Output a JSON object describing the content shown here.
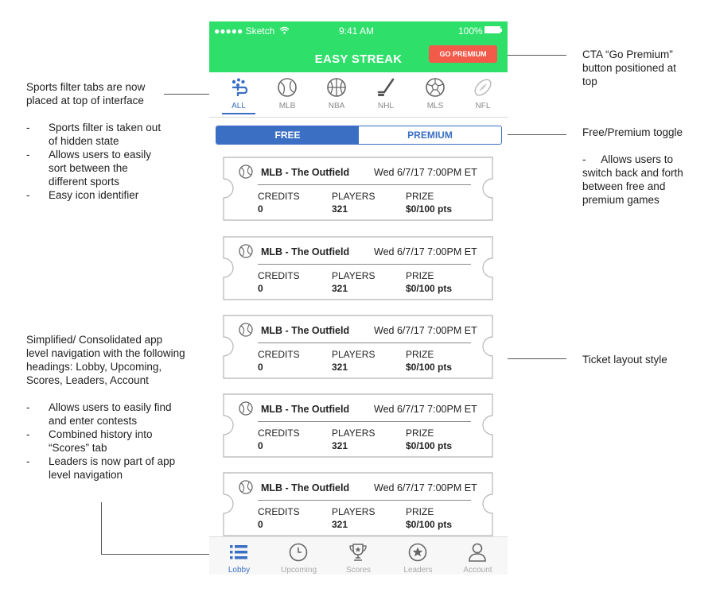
{
  "status_bar": {
    "carrier": "●●●●● Sketch",
    "time": "9:41 AM",
    "battery": "100%"
  },
  "header": {
    "title": "EASY STREAK",
    "premium_button": "GO PREMIUM"
  },
  "sport_tabs": [
    {
      "label": "ALL",
      "icon": "all-sports-icon",
      "active": true
    },
    {
      "label": "MLB",
      "icon": "baseball-icon"
    },
    {
      "label": "NBA",
      "icon": "basketball-icon"
    },
    {
      "label": "NHL",
      "icon": "hockey-icon"
    },
    {
      "label": "MLS",
      "icon": "soccer-icon"
    },
    {
      "label": "NFL",
      "icon": "football-icon"
    }
  ],
  "toggle": {
    "free": "FREE",
    "premium": "PREMIUM",
    "selected": "FREE"
  },
  "tickets": [
    {
      "name": "MLB - The Outfield",
      "date": "Wed 6/7/17 7:00PM ET",
      "credits_label": "CREDITS",
      "credits": "0",
      "players_label": "PLAYERS",
      "players": "321",
      "prize_label": "PRIZE",
      "prize": "$0/100 pts"
    },
    {
      "name": "MLB - The Outfield",
      "date": "Wed 6/7/17 7:00PM ET",
      "credits_label": "CREDITS",
      "credits": "0",
      "players_label": "PLAYERS",
      "players": "321",
      "prize_label": "PRIZE",
      "prize": "$0/100 pts"
    },
    {
      "name": "MLB - The Outfield",
      "date": "Wed 6/7/17 7:00PM ET",
      "credits_label": "CREDITS",
      "credits": "0",
      "players_label": "PLAYERS",
      "players": "321",
      "prize_label": "PRIZE",
      "prize": "$0/100 pts"
    },
    {
      "name": "MLB - The Outfield",
      "date": "Wed 6/7/17 7:00PM ET",
      "credits_label": "CREDITS",
      "credits": "0",
      "players_label": "PLAYERS",
      "players": "321",
      "prize_label": "PRIZE",
      "prize": "$0/100 pts"
    },
    {
      "name": "MLB - The Outfield",
      "date": "Wed 6/7/17 7:00PM ET",
      "credits_label": "CREDITS",
      "credits": "0",
      "players_label": "PLAYERS",
      "players": "321",
      "prize_label": "PRIZE",
      "prize": "$0/100 pts"
    }
  ],
  "bottom_nav": [
    {
      "label": "Lobby",
      "icon": "list-icon",
      "active": true
    },
    {
      "label": "Upcoming",
      "icon": "clock-icon"
    },
    {
      "label": "Scores",
      "icon": "trophy-icon"
    },
    {
      "label": "Leaders",
      "icon": "star-badge-icon"
    },
    {
      "label": "Account",
      "icon": "user-icon"
    }
  ],
  "annotations": {
    "sports_filter": {
      "title": "Sports filter tabs are now placed at top of interface",
      "bullets": [
        "Sports filter is taken out of hidden state",
        "Allows users to easily sort between the different sports",
        "Easy icon identifier"
      ]
    },
    "cta": {
      "title": "CTA “Go Premium” button positioned at top"
    },
    "toggle": {
      "title": "Free/Premium toggle",
      "bullets": [
        "Allows users to switch back and forth between free and premium games"
      ]
    },
    "ticket": {
      "title": "Ticket layout style"
    },
    "navigation": {
      "title": "Simplified/ Consolidated app level navigation with the following headings: Lobby, Upcoming, Scores, Leaders, Account",
      "bullets": [
        "Allows users to easily find and enter contests",
        "Combined history into “Scores” tab",
        "Leaders is now part of app level navigation"
      ]
    }
  },
  "colors": {
    "green": "#2ee06a",
    "blue": "#3a6fc4",
    "red": "#f25a4a"
  }
}
